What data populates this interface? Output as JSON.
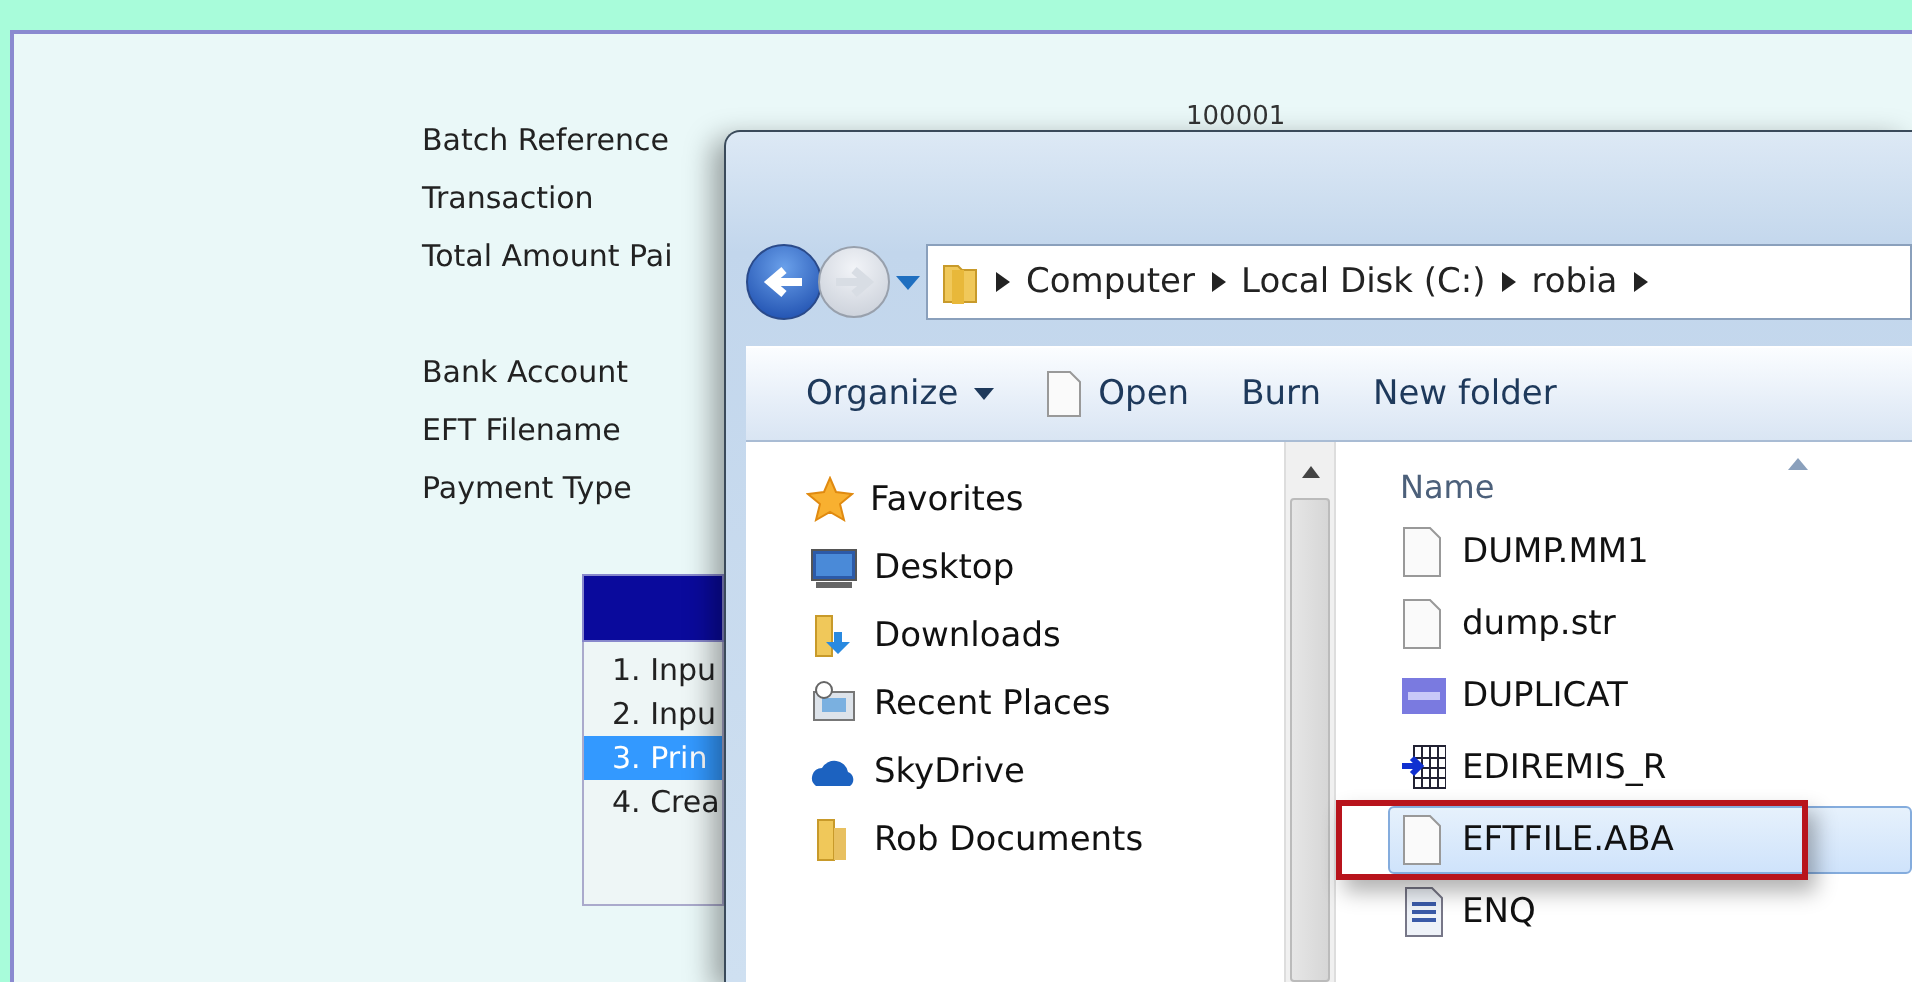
{
  "form": {
    "labels": [
      {
        "text": "Batch Reference"
      },
      {
        "text": "Transaction"
      },
      {
        "text": "Total Amount Pai"
      },
      {
        "text": "Bank Account",
        "spaced": true
      },
      {
        "text": "EFT Filename"
      },
      {
        "text": "Payment Type"
      }
    ],
    "value": "100001",
    "menu": [
      {
        "label": "1. Inpu",
        "selected": false
      },
      {
        "label": "2. Inpu",
        "selected": false
      },
      {
        "label": "3. Prin",
        "selected": true
      },
      {
        "label": "4. Crea",
        "selected": false
      }
    ]
  },
  "dialog": {
    "address": [
      "Computer",
      "Local Disk (C:)",
      "robia"
    ],
    "toolbar": [
      {
        "label": "Organize",
        "kind": "dropdown"
      },
      {
        "label": "Open",
        "kind": "open"
      },
      {
        "label": "Burn",
        "kind": "plain"
      },
      {
        "label": "New folder",
        "kind": "plain"
      }
    ],
    "nav": [
      {
        "label": "Favorites",
        "kind": "group"
      },
      {
        "label": "Desktop",
        "kind": "desktop"
      },
      {
        "label": "Downloads",
        "kind": "downloads"
      },
      {
        "label": "Recent Places",
        "kind": "recent"
      },
      {
        "label": "SkyDrive",
        "kind": "cloud"
      },
      {
        "label": "Rob Documents",
        "kind": "folder"
      }
    ],
    "column": "Name",
    "files": [
      {
        "name": "DUMP.MM1",
        "kind": "document",
        "selected": false
      },
      {
        "name": "dump.str",
        "kind": "document",
        "selected": false
      },
      {
        "name": "DUPLICAT",
        "kind": "bld",
        "selected": false
      },
      {
        "name": "EDIREMIS_R",
        "kind": "table",
        "selected": false
      },
      {
        "name": "EFTFILE.ABA",
        "kind": "document",
        "selected": true,
        "highlighted": true
      },
      {
        "name": "ENQ",
        "kind": "text",
        "selected": false
      }
    ]
  }
}
